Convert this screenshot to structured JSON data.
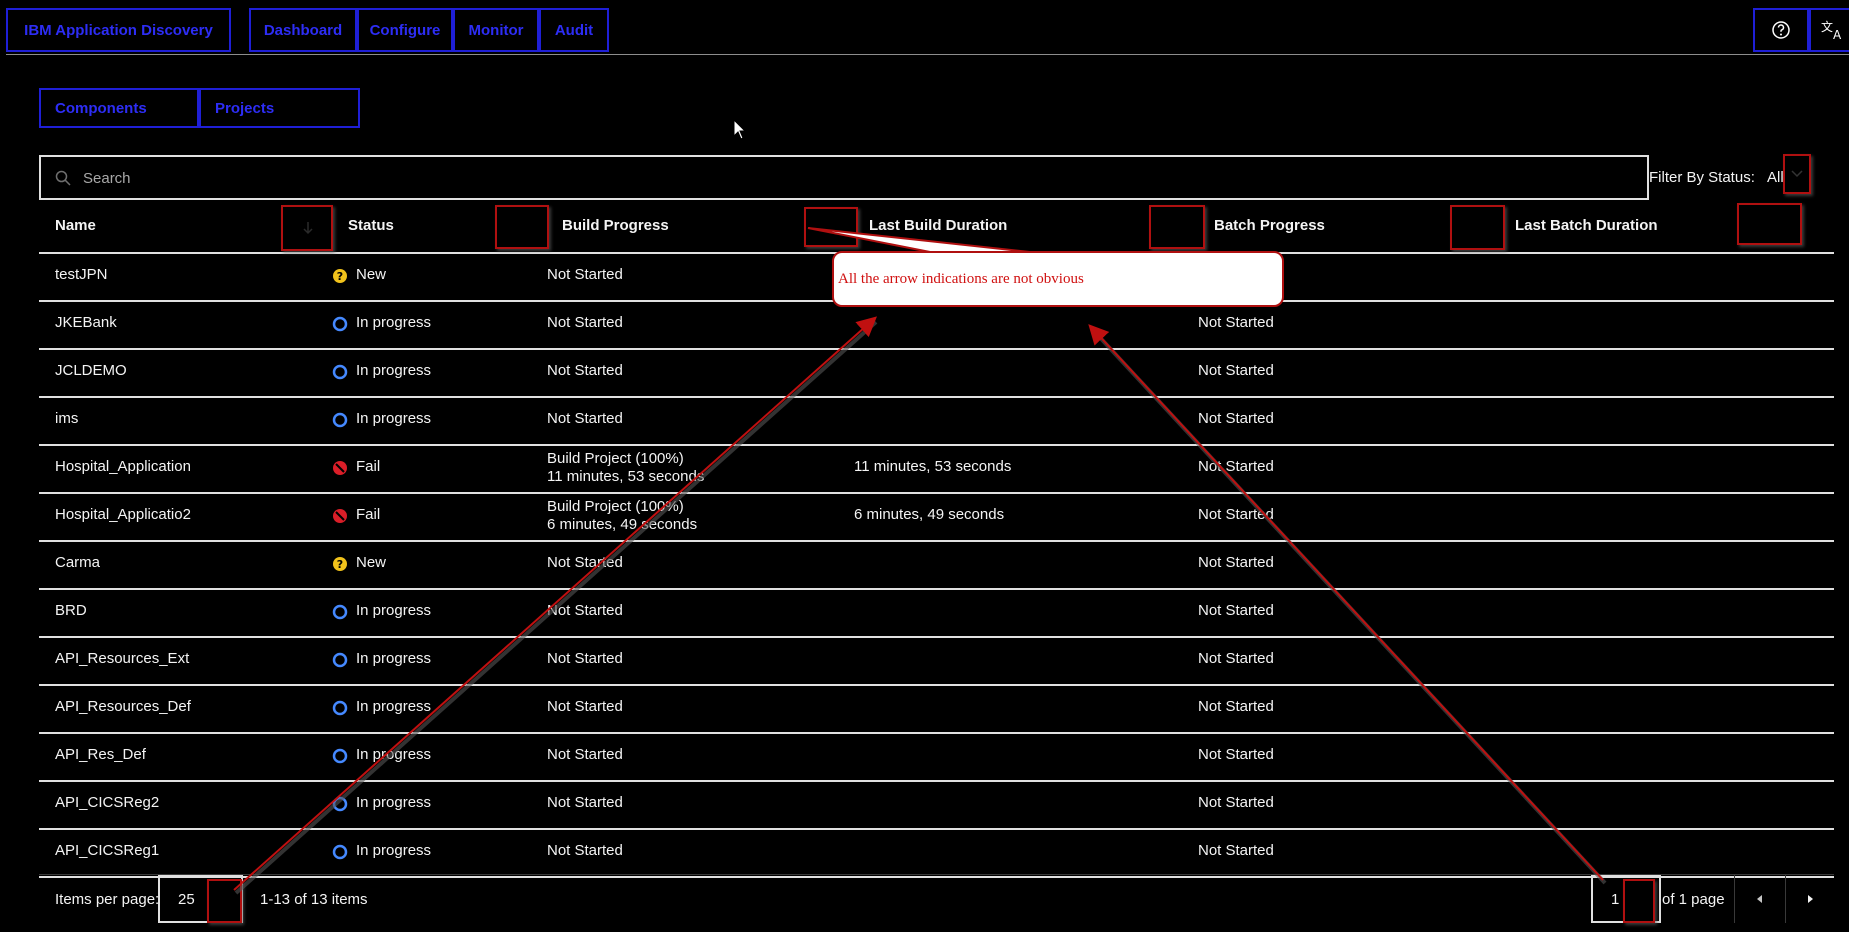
{
  "header": {
    "brand": "IBM Application Discovery",
    "nav": [
      "Dashboard",
      "Configure",
      "Monitor",
      "Audit"
    ]
  },
  "tabs": [
    "Components",
    "Projects"
  ],
  "search": {
    "placeholder": "Search"
  },
  "filter": {
    "label": "Filter By Status:",
    "value": "All"
  },
  "table": {
    "columns": [
      "Name",
      "Status",
      "Build Progress",
      "Last Build Duration",
      "Batch Progress",
      "Last Batch Duration"
    ],
    "rows": [
      {
        "name": "testJPN",
        "status": "New",
        "status_type": "new",
        "build": "Not Started",
        "build2": "",
        "last_build": "",
        "batch": "Not Started"
      },
      {
        "name": "JKEBank",
        "status": "In progress",
        "status_type": "progress",
        "build": "Not Started",
        "build2": "",
        "last_build": "",
        "batch": "Not Started"
      },
      {
        "name": "JCLDEMO",
        "status": "In progress",
        "status_type": "progress",
        "build": "Not Started",
        "build2": "",
        "last_build": "",
        "batch": "Not Started"
      },
      {
        "name": "ims",
        "status": "In progress",
        "status_type": "progress",
        "build": "Not Started",
        "build2": "",
        "last_build": "",
        "batch": "Not Started"
      },
      {
        "name": "Hospital_Application",
        "status": "Fail",
        "status_type": "fail",
        "build": "Build Project (100%)",
        "build2": "11 minutes, 53 seconds",
        "last_build": "11 minutes, 53 seconds",
        "batch": "Not Started"
      },
      {
        "name": "Hospital_Applicatio2",
        "status": "Fail",
        "status_type": "fail",
        "build": "Build Project (100%)",
        "build2": "6 minutes, 49 seconds",
        "last_build": "6 minutes, 49 seconds",
        "batch": "Not Started"
      },
      {
        "name": "Carma",
        "status": "New",
        "status_type": "new",
        "build": "Not Started",
        "build2": "",
        "last_build": "",
        "batch": "Not Started"
      },
      {
        "name": "BRD",
        "status": "In progress",
        "status_type": "progress",
        "build": "Not Started",
        "build2": "",
        "last_build": "",
        "batch": "Not Started"
      },
      {
        "name": "API_Resources_Ext",
        "status": "In progress",
        "status_type": "progress",
        "build": "Not Started",
        "build2": "",
        "last_build": "",
        "batch": "Not Started"
      },
      {
        "name": "API_Resources_Def",
        "status": "In progress",
        "status_type": "progress",
        "build": "Not Started",
        "build2": "",
        "last_build": "",
        "batch": "Not Started"
      },
      {
        "name": "API_Res_Def",
        "status": "In progress",
        "status_type": "progress",
        "build": "Not Started",
        "build2": "",
        "last_build": "",
        "batch": "Not Started"
      },
      {
        "name": "API_CICSReg2",
        "status": "In progress",
        "status_type": "progress",
        "build": "Not Started",
        "build2": "",
        "last_build": "",
        "batch": "Not Started"
      },
      {
        "name": "API_CICSReg1",
        "status": "In progress",
        "status_type": "progress",
        "build": "Not Started",
        "build2": "",
        "last_build": "",
        "batch": "Not Started"
      }
    ]
  },
  "pagination": {
    "items_per_page_label": "Items per page:",
    "items_per_page": "25",
    "range": "1-13 of 13 items",
    "page": "1",
    "of_pages": "of 1 page"
  },
  "annotation": {
    "text": "All the arrow indications are not obvious"
  },
  "colors": {
    "accent_blue": "#1f1fd6",
    "annotation_red": "#b01010",
    "status_new": "#f1c21b",
    "status_progress": "#4589ff",
    "status_fail": "#da1e28"
  }
}
